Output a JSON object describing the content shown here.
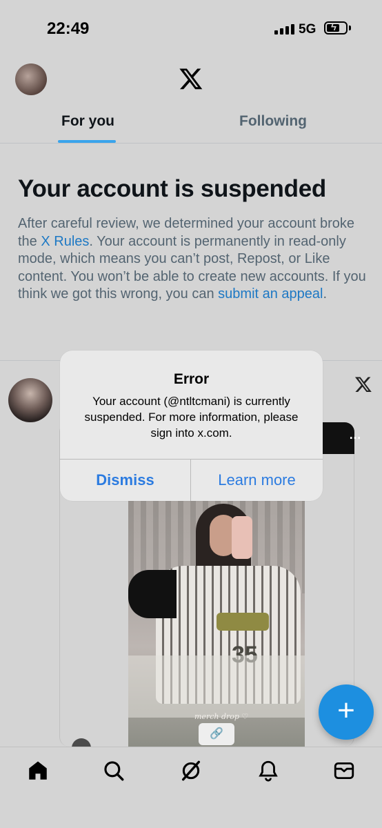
{
  "status_bar": {
    "time": "22:49",
    "network": "5G"
  },
  "tabs": [
    {
      "label": "For you",
      "active": true
    },
    {
      "label": "Following",
      "active": false
    }
  ],
  "suspension": {
    "title": "Your account is suspended",
    "body_part1": "After careful review, we determined your account broke the ",
    "rules_link": "X Rules",
    "body_part2": ". Your account is permanently in read-only mode, which means you can’t post, Repost, or Like content. You won’t be able to create new accounts. If you think we got this wrong, you can ",
    "appeal_link": "submit an appeal",
    "body_part3": "."
  },
  "post": {
    "media_caption": "merch drop ♡",
    "more_icon": "…"
  },
  "dialog": {
    "title": "Error",
    "message": "Your account (@ntltcmani) is currently suspended. For more information, please sign into x.com.",
    "dismiss_label": "Dismiss",
    "learn_more_label": "Learn more"
  },
  "fab_label": "+",
  "bottom_nav": [
    "home-icon",
    "search-icon",
    "grok-icon",
    "notifications-icon",
    "messages-icon"
  ],
  "colors": {
    "accent": "#1d9bf0",
    "link": "#1d78c4",
    "dialog_button": "#2b7be0"
  }
}
